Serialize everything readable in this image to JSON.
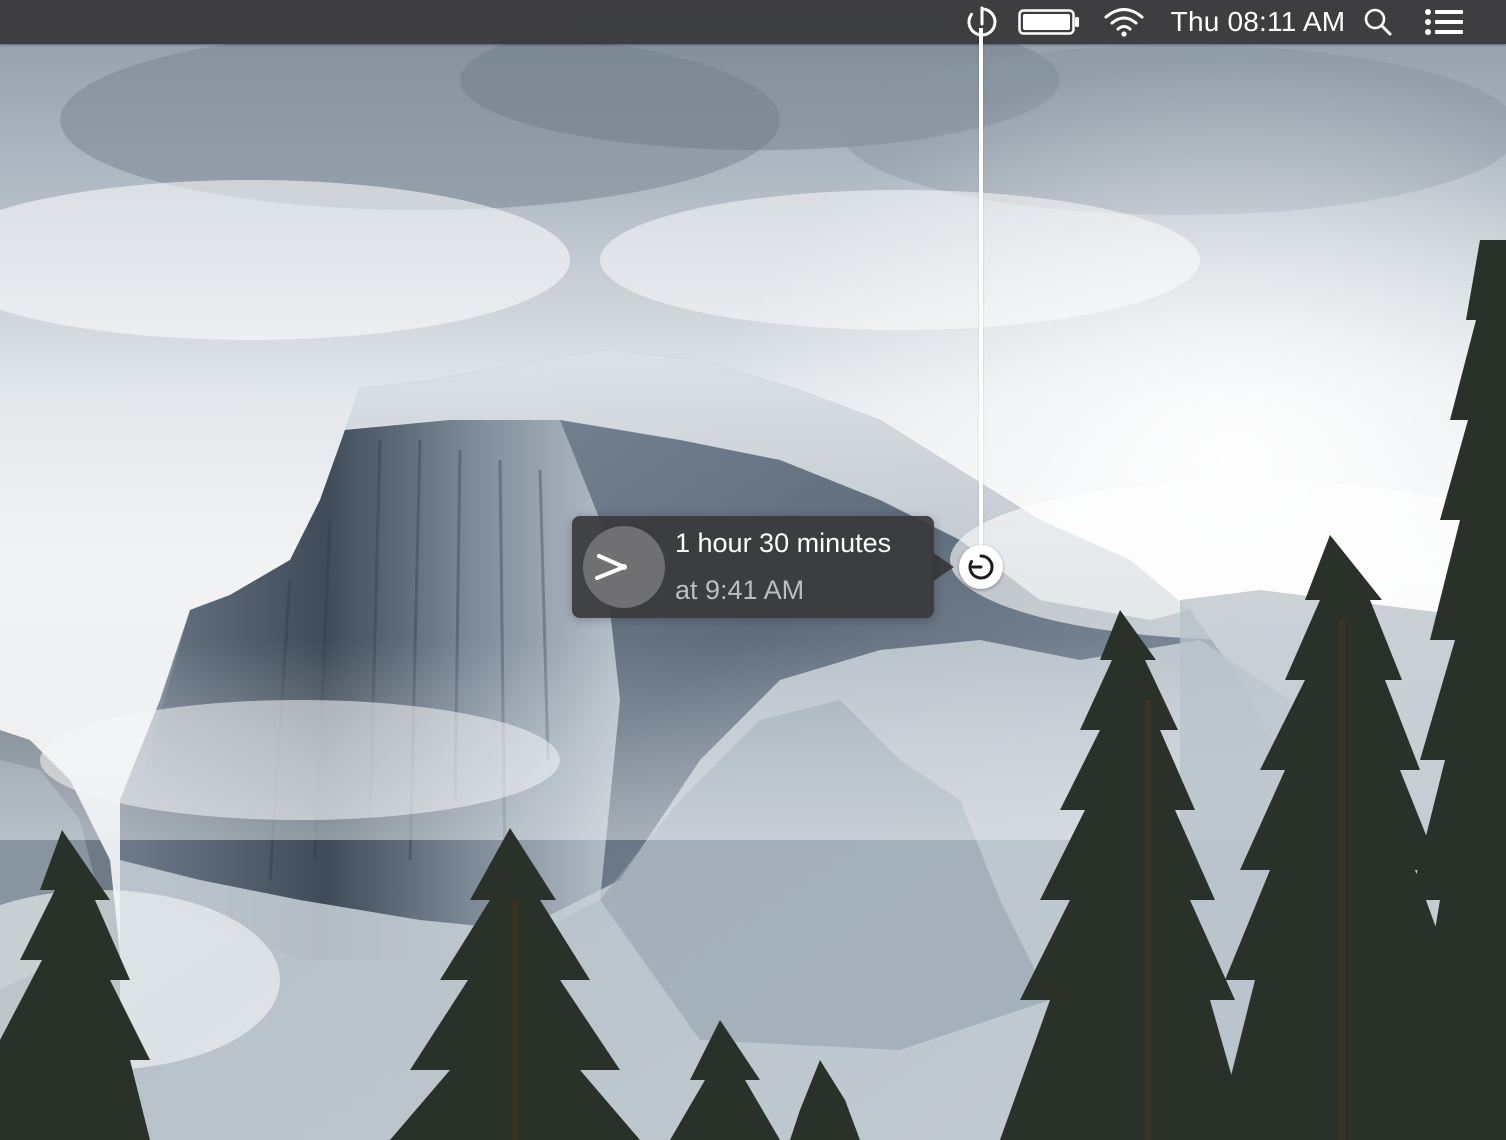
{
  "menubar": {
    "timer_icon": "timer-icon",
    "battery_icon": "battery-icon",
    "wifi_icon": "wifi-icon",
    "clock_text": "Thu 08:11 AM",
    "search_icon": "spotlight-search-icon",
    "notification_icon": "notification-center-icon"
  },
  "timer": {
    "duration_text": "1 hour 30 minutes",
    "end_time_text": "at 9:41 AM",
    "clock_icon": "clock-face-icon",
    "handle_icon": "timer-handle-icon"
  },
  "wallpaper": {
    "description_icon": "mountain-wallpaper"
  },
  "colors": {
    "menubar_bg": "#3a3a3c",
    "tooltip_bg": "#38383a",
    "tooltip_secondary_text": "#bdbdc0",
    "accent_white": "#ffffff"
  }
}
